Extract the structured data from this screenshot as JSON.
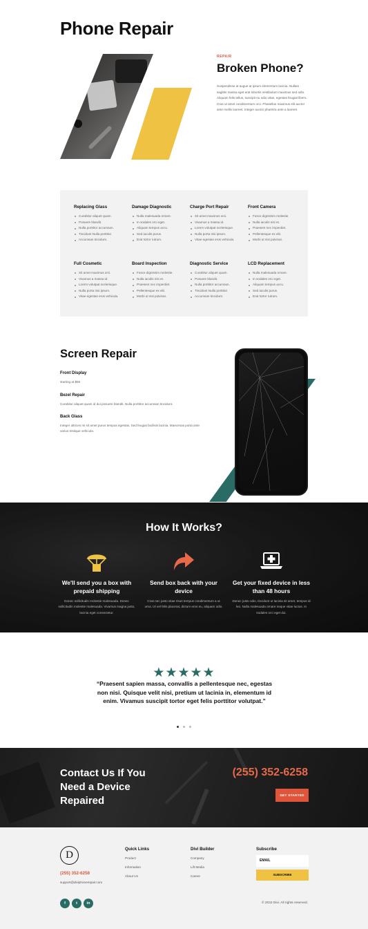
{
  "page": {
    "title": "Phone Repair"
  },
  "hero": {
    "eyebrow": "REPAIR",
    "heading": "Broken Phone?",
    "body": "Suspendisse at augue at ipsum elementum lacinia. Nullam sagittis massa eget erat lobortis vestibulum maximus sed odio. Aliquam felis tellus, suscipit eu odio vitae, egestas feugiat libero. Cras ut amet condimentum orci. Phasellus maximus elit auctor ante mollis laoreet. Integer auctor pharetra ante a laoreet.",
    "colors": {
      "accent_yellow": "#efc244",
      "eyebrow_red": "#e0553a"
    }
  },
  "services": [
    {
      "title": "Replacing Glass",
      "items": [
        "Curabitur aliquet quam.",
        "Posuere blandit.",
        "Nulla porttitor accumsan.",
        "Tincidunt Nulla porttitor.",
        "Accumsan tincidunt."
      ]
    },
    {
      "title": "Damage Diagnostic",
      "items": [
        "Nulla malesuada ornare.",
        "In sodales orci eget.",
        "Aliquam tempus accu.",
        "Sed iaculis purus.",
        "Erat tortor rutrum."
      ]
    },
    {
      "title": "Charge Port Repair",
      "items": [
        "Sit amet maximus orci.",
        "Vivamus a massa id.",
        "Lorem volutpat scelerisque.",
        "Nulla porta nisi ipsum.",
        "Vitae egestas eros vehicula."
      ]
    },
    {
      "title": "Front Camera",
      "items": [
        "Fusce dignissim molestie.",
        "Nulla iaculis nisi et.",
        "Praesent nec imperdiet.",
        "Pellentesque ex elit.",
        "Morbi ut nisi pulvinar."
      ]
    },
    {
      "title": "Full Cosmetic",
      "items": [
        "Sit amet maximus orci.",
        "Vivamus a massa id.",
        "Lorem volutpat scelerisque.",
        "Nulla porta nisi ipsum.",
        "Vitae egestas eros vehicula."
      ]
    },
    {
      "title": "Board Inspection",
      "items": [
        "Fusce dignissim molestie.",
        "Nulla iaculis nisi et.",
        "Praesent nec imperdiet.",
        "Pellentesque ex elit.",
        "Morbi ut nisi pulvinar."
      ]
    },
    {
      "title": "Diagnostic Service",
      "items": [
        "Curabitur aliquet quam.",
        "Posuere blandit.",
        "Nulla porttitor accumsan.",
        "Tincidunt Nulla porttitor.",
        "Accumsan tincidunt."
      ]
    },
    {
      "title": "LCD Replacement",
      "items": [
        "Nulla malesuada ornare.",
        "In sodales orci eget.",
        "Aliquam tempus accu.",
        "Sed iaculis purus.",
        "Erat tortor rutrum."
      ]
    }
  ],
  "screen_repair": {
    "heading": "Screen Repair",
    "items": [
      {
        "title": "Front Display",
        "desc": "starting at $59"
      },
      {
        "title": "Bezel Repair",
        "desc": "Curabitur aliquet quam id dui posuere blandit. Nulla porttitor accumsan tincidunt."
      },
      {
        "title": "Back Glass",
        "desc": "Integer ultrices mi sit amet purus tempus egestas. Sed feugiat facilisis lacinia. Maecenas porta ante varius tristique vehicula."
      }
    ],
    "colors": {
      "teal": "#2a6b65"
    }
  },
  "how_it_works": {
    "heading": "How It Works?",
    "steps": [
      {
        "icon": "parachute-box-icon",
        "title": "We'll send you a box with prepaid shipping",
        "text": "Donec sollicitudin molestie malesuada. Donec sollicitudin molestie malesuada. Vivamus magna justo, lacinia eget consectetur."
      },
      {
        "icon": "share-arrow-icon",
        "title": "Send box back with your device",
        "text": "Cras nec justo vitae risus tempus condimentum a ut urna. Ut vel felis placerat, dictum eros eu, aliquam odio."
      },
      {
        "icon": "laptop-medical-icon",
        "title": "Get your fixed device in less than 48 hours",
        "text": "Donec justo odio, tincidunt ut lacinia sit amet, tempus id leo. Nulla malesuada ornare neque vitae luctus. In sodales orci eget dui."
      }
    ],
    "colors": {
      "icon_yellow": "#efc244",
      "icon_orange": "#e8694a"
    }
  },
  "testimonial": {
    "stars": "★★★★★",
    "rating": 5,
    "quote": "“Praesent sapien massa, convallis a pellentesque nec, egestas non nisi. Quisque velit nisi, pretium ut lacinia in, elementum id enim. Vivamus suscipit tortor eget felis porttitor volutpat.”"
  },
  "contact": {
    "heading": "Contact Us If You Need a Device Repaired",
    "phone": "(255) 352-6258",
    "button": "GET STARTED"
  },
  "footer": {
    "logo_letter": "D",
    "phone": "(255) 352-6258",
    "email": "support@diviphonerepair.com",
    "quick_links_title": "Quick Links",
    "quick_links": [
      "Product",
      "Information",
      "About Us"
    ],
    "divi_title": "Divi Builder",
    "divi_links": [
      "Company",
      "Lift Media",
      "Career"
    ],
    "subscribe_title": "Subscribe",
    "email_placeholder": "EMAIL",
    "subscribe_button": "SUBSCRIBE",
    "socials": [
      "f",
      "t",
      "in"
    ],
    "copyright": "© 2022 Divi. All rights reserved."
  }
}
